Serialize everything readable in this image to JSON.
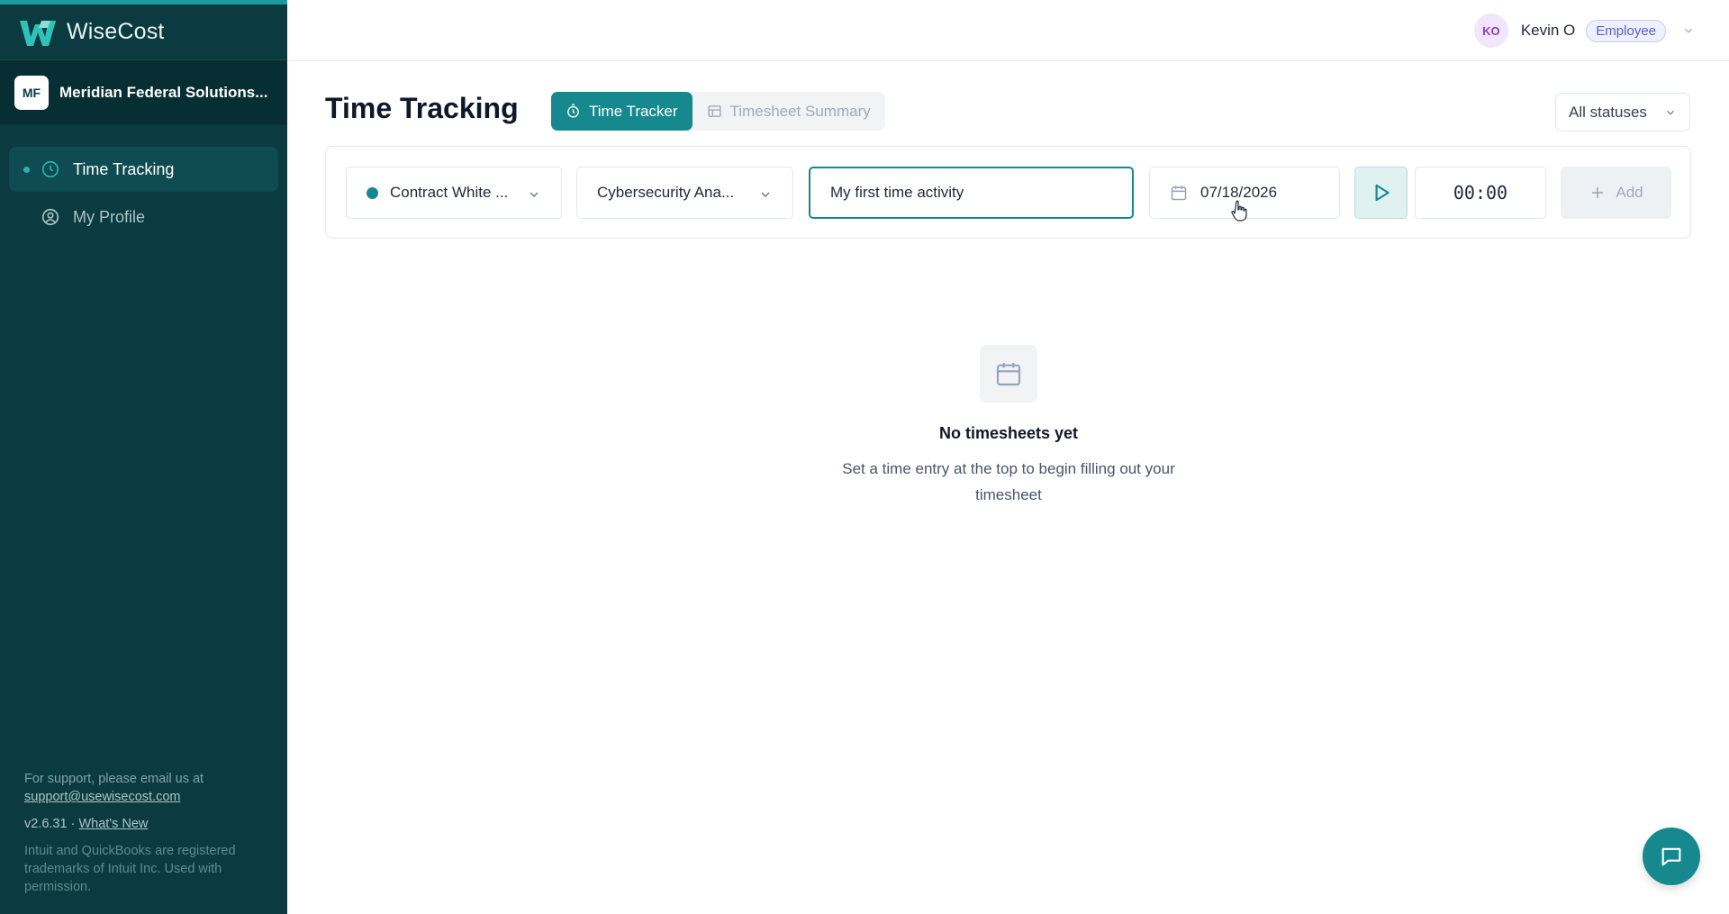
{
  "app": {
    "name": "WiseCost",
    "accent": "#16898f",
    "sidebar_bg": "#0b3b40"
  },
  "org": {
    "initials": "MF",
    "name": "Meridian Federal Solutions..."
  },
  "sidebar": {
    "items": [
      {
        "label": "Time Tracking",
        "icon": "clock-icon",
        "active": true
      },
      {
        "label": "My Profile",
        "icon": "user-circle-icon",
        "active": false
      }
    ],
    "footer": {
      "support_text": "For support, please email us at",
      "support_email": "support@usewisecost.com",
      "version": "v2.6.31 ·",
      "whats_new": "What's New",
      "legal": "Intuit and QuickBooks are registered trademarks of Intuit Inc. Used with permission."
    }
  },
  "header": {
    "user_initials": "KO",
    "user_name": "Kevin O",
    "role": "Employee"
  },
  "page": {
    "title": "Time Tracking",
    "tabs": [
      {
        "label": "Time Tracker",
        "icon": "stopwatch-icon",
        "active": true
      },
      {
        "label": "Timesheet Summary",
        "icon": "table-icon",
        "active": false
      }
    ],
    "status_filter": "All statuses"
  },
  "tracker": {
    "contract": "Contract White ...",
    "labor_category": "Cybersecurity Ana...",
    "description_value": "My first time activity",
    "date": "07/18/2026",
    "timer": "00:00",
    "add_label": "Add"
  },
  "empty_state": {
    "title": "No timesheets yet",
    "text": "Set a time entry at the top to begin filling out your timesheet"
  }
}
